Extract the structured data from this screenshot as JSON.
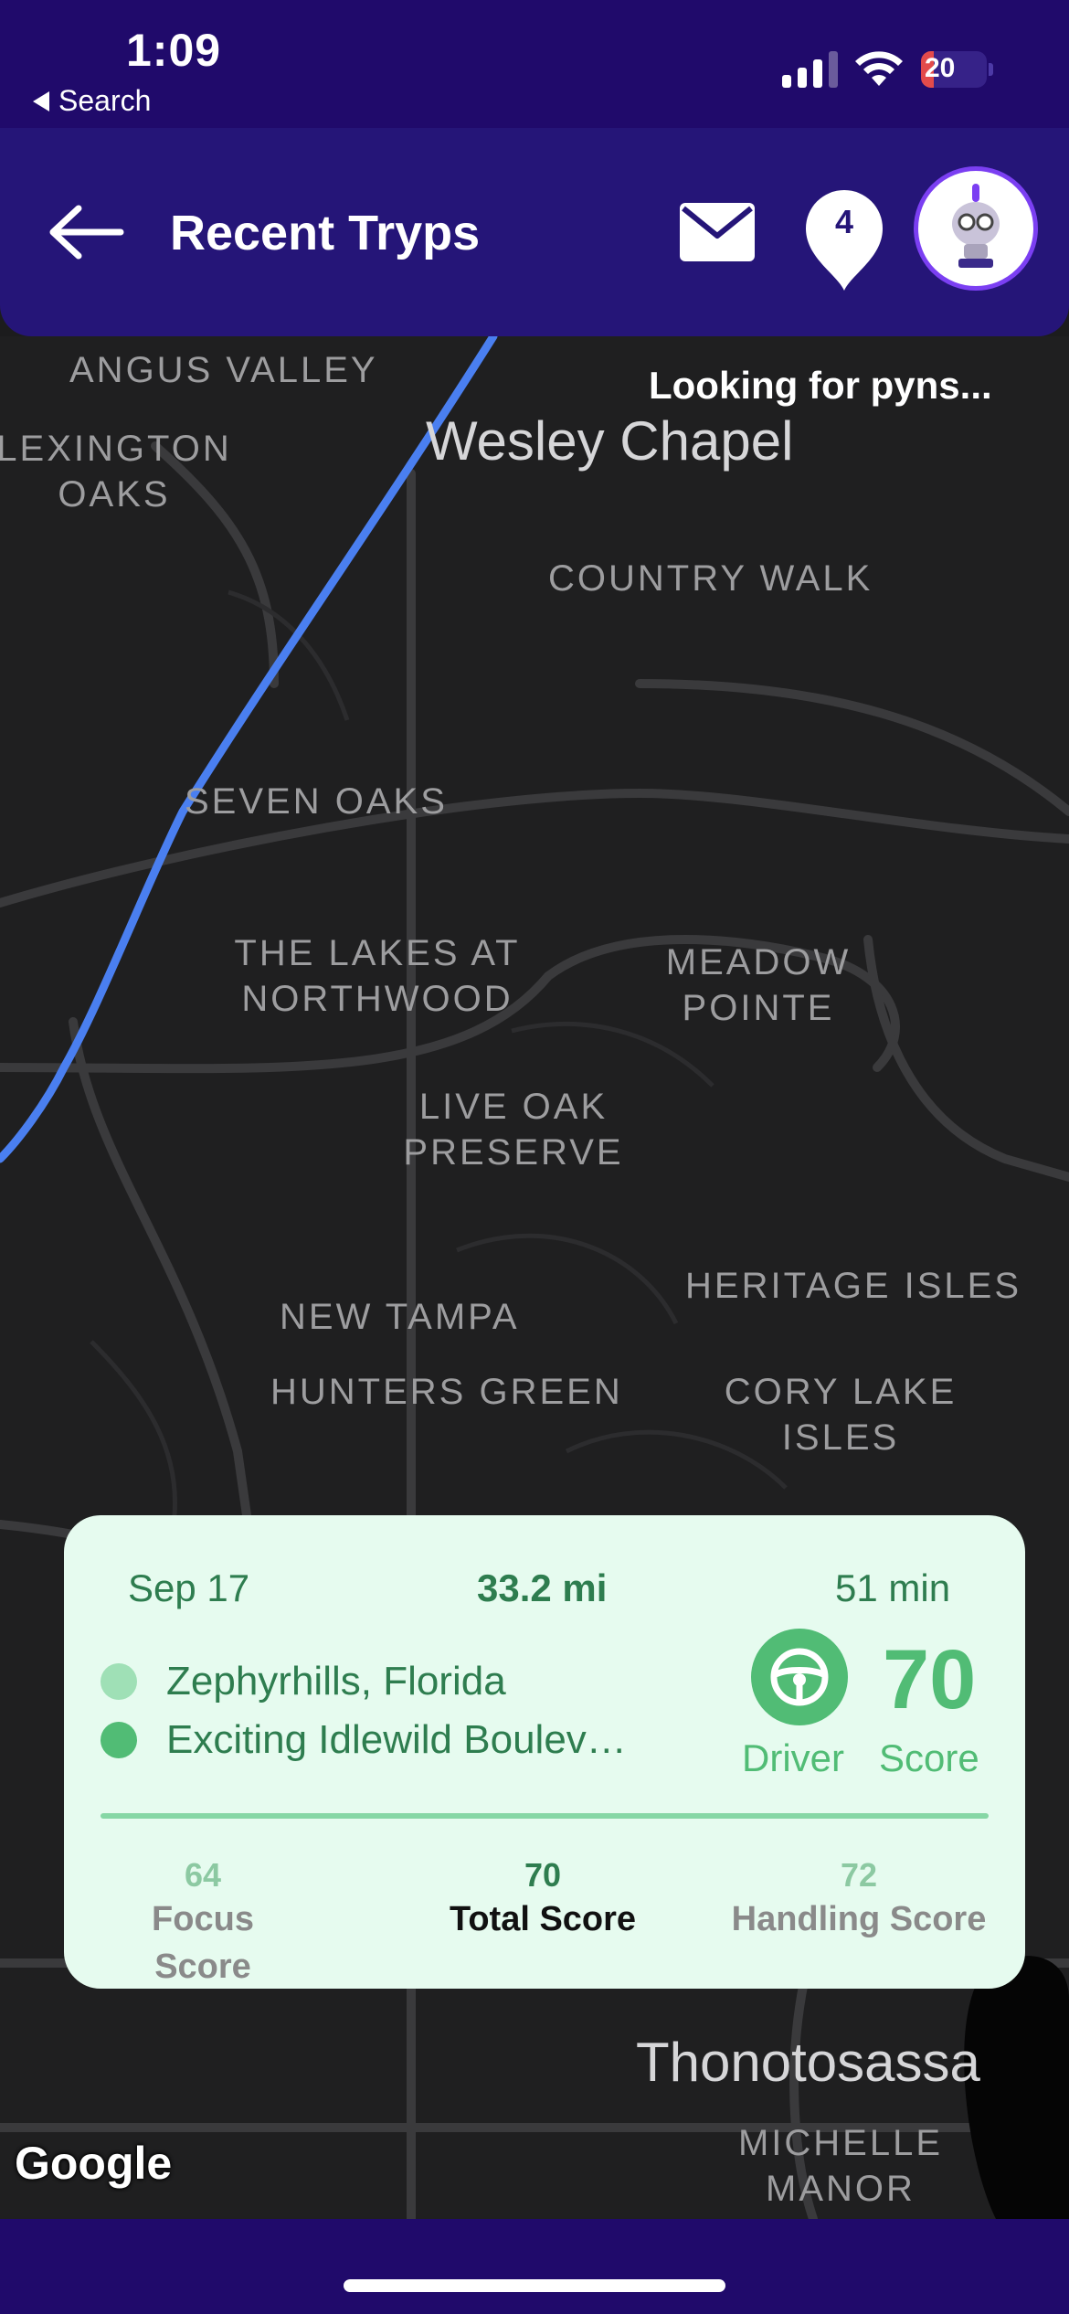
{
  "status_bar": {
    "time": "1:09",
    "back_app_label": "Search",
    "battery_level": "20",
    "battery_fraction": 0.2,
    "icons": [
      "cellular-signal-icon",
      "wifi-icon",
      "battery-charging-icon"
    ]
  },
  "header": {
    "back_icon": "arrow-left-icon",
    "title": "Recent Tryps",
    "mail_icon": "mail-icon",
    "pyn_count": "4",
    "avatar_icon": "robot-avatar-icon",
    "colors": {
      "background": "#251578",
      "accent_ring": "#7b3ff2"
    }
  },
  "map": {
    "status_text": "Looking for pyns...",
    "attribution": "Google",
    "places": [
      {
        "id": "angus-valley",
        "label": "ANGUS VALLEY"
      },
      {
        "id": "lexington-oaks",
        "label": "LEXINGTON OAKS"
      },
      {
        "id": "country-walk",
        "label": "COUNTRY WALK"
      },
      {
        "id": "seven-oaks",
        "label": "SEVEN OAKS"
      },
      {
        "id": "lakes-northwood",
        "label": "THE LAKES AT NORTHWOOD"
      },
      {
        "id": "meadow-pointe",
        "label": "MEADOW POINTE"
      },
      {
        "id": "live-oak-preserve",
        "label": "LIVE OAK PRESERVE"
      },
      {
        "id": "heritage-isles",
        "label": "HERITAGE ISLES"
      },
      {
        "id": "new-tampa",
        "label": "NEW TAMPA"
      },
      {
        "id": "hunters-green",
        "label": "HUNTERS GREEN"
      },
      {
        "id": "cory-lake-isles",
        "label": "CORY LAKE ISLES"
      },
      {
        "id": "michelle-manor",
        "label": "MICHELLE MANOR"
      }
    ],
    "cities": {
      "wesley_chapel": "Wesley Chapel",
      "thonotosassa": "Thonotosassa"
    },
    "route_color": "#4a7ff0"
  },
  "trip_card": {
    "date": "Sep 17",
    "distance": "33.2 mi",
    "duration": "51 min",
    "origin": "Zephyrhills, Florida",
    "destination": "Exciting Idlewild Boulev…",
    "driver_label": "Driver",
    "driver_icon": "steering-wheel-icon",
    "score_value": "70",
    "score_label": "Score",
    "focus": {
      "value": "64",
      "label": "Focus Score"
    },
    "total": {
      "value": "70",
      "label": "Total Score"
    },
    "handling": {
      "value": "72",
      "label": "Handling Score"
    },
    "colors": {
      "card": "#e6fbef",
      "accent": "#51bc75",
      "origin_dot": "#9fe0b6",
      "destination_dot": "#51bc75",
      "muted": "#8cc9a2"
    }
  }
}
